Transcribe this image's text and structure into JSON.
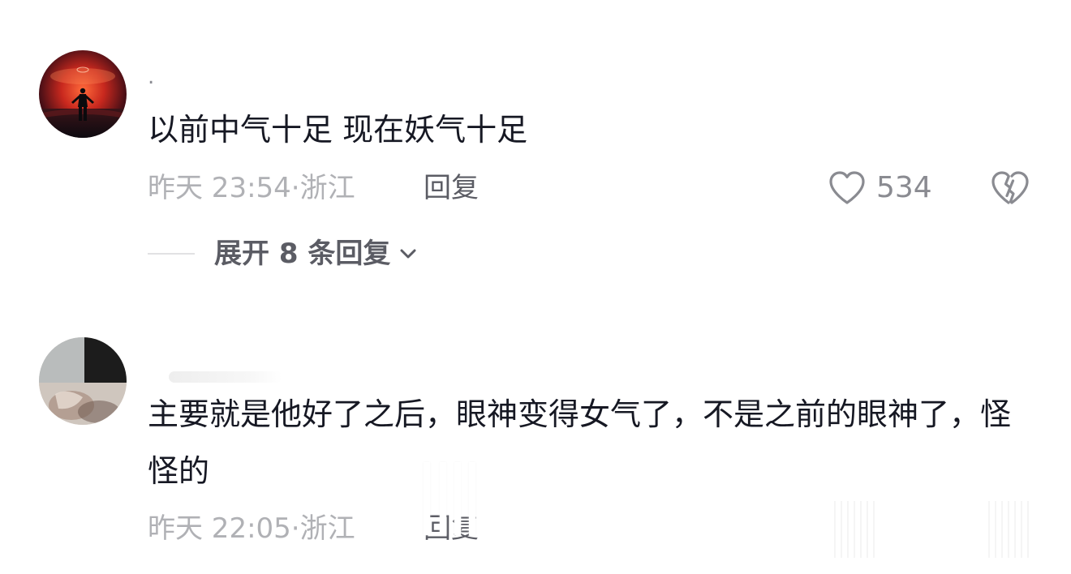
{
  "comments": [
    {
      "username": ".",
      "text": "以前中气十足 现在妖气十足",
      "time": "昨天 23:54",
      "location": "浙江",
      "reply_label": "回复",
      "likes": "534",
      "expand_label": "展开 8 条回复"
    },
    {
      "text": "主要就是他好了之后，眼神变得女气了，不是之前的眼神了，怪怪的",
      "time": "昨天 22:05",
      "location": "浙江",
      "reply_label": "回复"
    }
  ],
  "icons": {
    "like": "heart-outline-icon",
    "dislike": "broken-heart-icon",
    "expand": "chevron-down-icon"
  },
  "colors": {
    "text_primary": "#161823",
    "text_secondary": "#b0b1b5",
    "text_action": "#5b5c64"
  }
}
